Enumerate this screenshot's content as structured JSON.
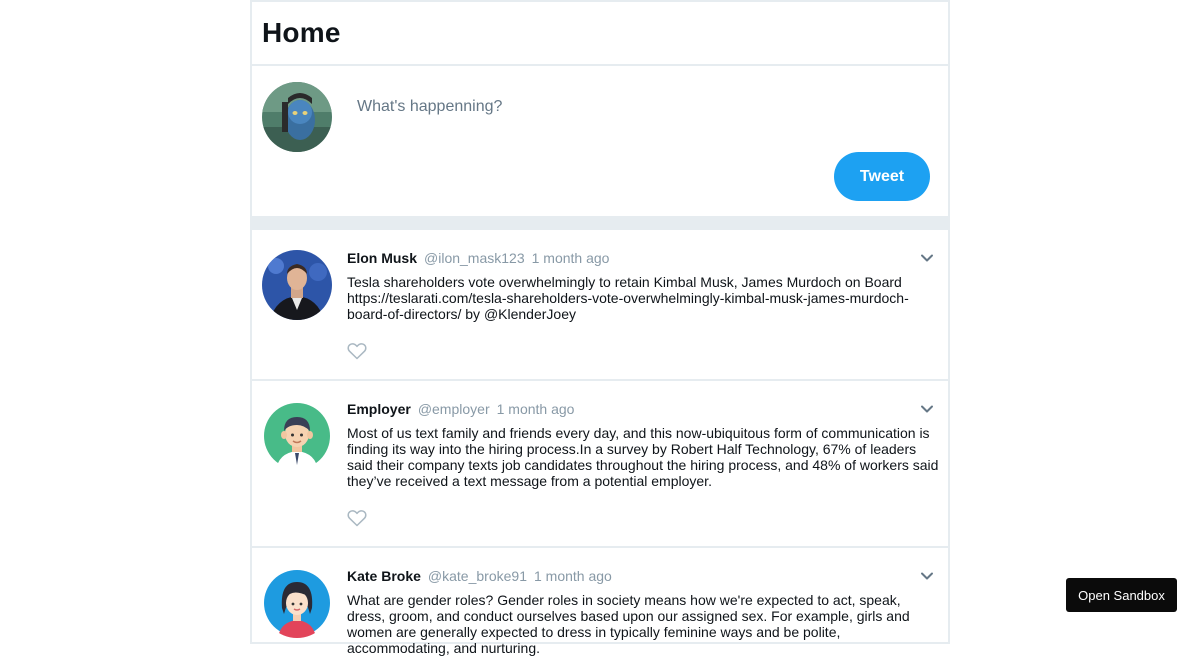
{
  "header": {
    "title": "Home"
  },
  "composer": {
    "placeholder": "What's happenning?",
    "button_label": "Tweet"
  },
  "posts": [
    {
      "name": "Elon Musk",
      "handle": "@ilon_mask123",
      "time": "1 month ago",
      "text": "Tesla shareholders vote overwhelmingly to retain Kimbal Musk, James Murdoch on Board https://teslarati.com/tesla-shareholders-vote-overwhelmingly-kimbal-musk-james-murdoch-board-of-directors/ by @KlenderJoey"
    },
    {
      "name": "Employer",
      "handle": "@employer",
      "time": "1 month ago",
      "text": "Most of us text family and friends every day, and this now-ubiquitous form of communication is finding its way into the hiring process.In a survey by Robert Half Technology, 67% of leaders said their company texts job candidates throughout the hiring process, and 48% of workers said they’ve received a text message from a potential employer."
    },
    {
      "name": "Kate Broke",
      "handle": "@kate_broke91",
      "time": "1 month ago",
      "text": "What are gender roles? Gender roles in society means how we're expected to act, speak, dress, groom, and conduct ourselves based upon our assigned sex. For example, girls and women are generally expected to dress in typically feminine ways and be polite, accommodating, and nurturing."
    }
  ],
  "sandbox": {
    "label": "Open Sandbox"
  },
  "colors": {
    "accent": "#1da1f2",
    "border": "#e6ecf0",
    "muted": "#8899a6"
  }
}
